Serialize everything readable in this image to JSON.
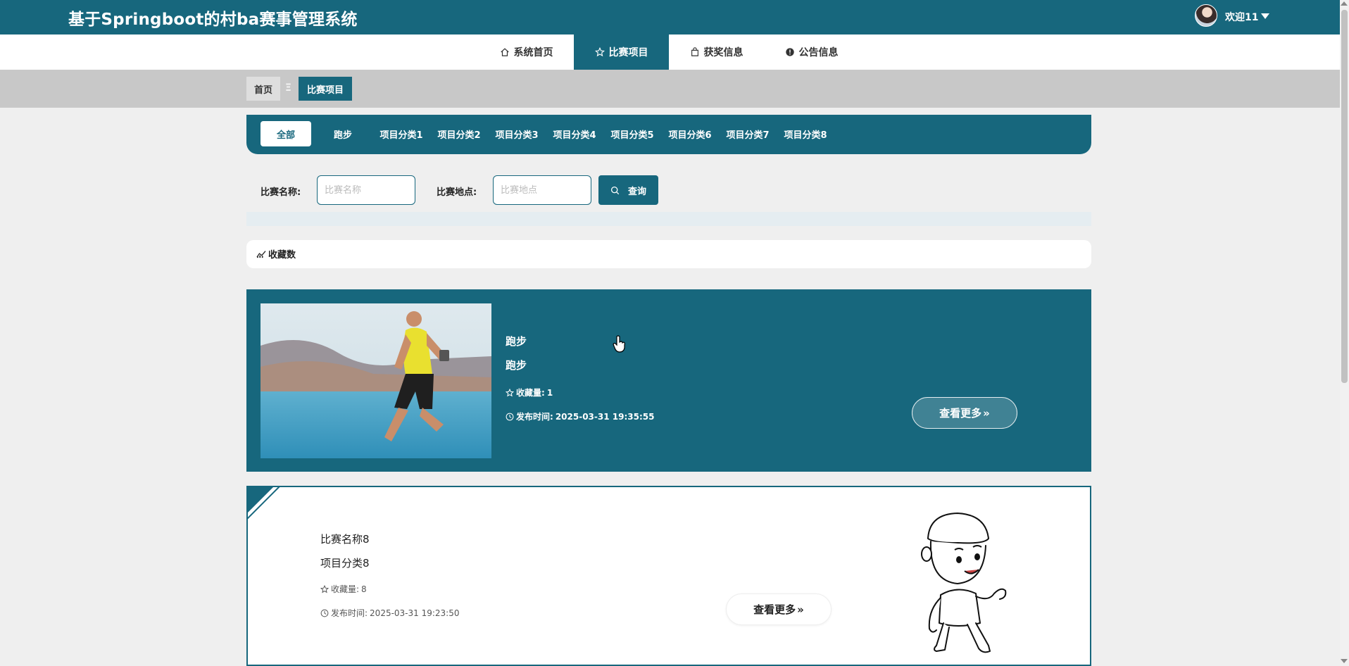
{
  "header": {
    "title": "基于Springboot的村ba赛事管理系统",
    "welcome": "欢迎11"
  },
  "nav": [
    {
      "label": "系统首页",
      "icon": "home-icon"
    },
    {
      "label": "比赛项目",
      "icon": "star-icon",
      "active": true
    },
    {
      "label": "获奖信息",
      "icon": "bag-icon"
    },
    {
      "label": "公告信息",
      "icon": "info-icon"
    }
  ],
  "breadcrumb": {
    "home": "首页",
    "separator": "Ξ",
    "current": "比赛项目"
  },
  "categories": [
    {
      "label": "全部",
      "active": true
    },
    {
      "label": "跑步"
    },
    {
      "label": "项目分类1"
    },
    {
      "label": "项目分类2"
    },
    {
      "label": "项目分类3"
    },
    {
      "label": "项目分类4"
    },
    {
      "label": "项目分类5"
    },
    {
      "label": "项目分类6"
    },
    {
      "label": "项目分类7"
    },
    {
      "label": "项目分类8"
    }
  ],
  "search": {
    "name_label": "比赛名称:",
    "name_placeholder": "比赛名称",
    "name_value": "",
    "place_label": "比赛地点:",
    "place_placeholder": "比赛地点",
    "place_value": "",
    "button": "查询"
  },
  "sort": {
    "label": "收藏数"
  },
  "items": [
    {
      "name": "跑步",
      "category": "跑步",
      "fav_label": "收藏量:",
      "fav_count": "1",
      "time_label": "发布时间:",
      "time": "2025-03-31 19:35:55",
      "more": "查看更多"
    },
    {
      "name": "比赛名称8",
      "category": "项目分类8",
      "fav_label": "收藏量:",
      "fav_count": "8",
      "time_label": "发布时间:",
      "time": "2025-03-31 19:23:50",
      "more": "查看更多"
    }
  ],
  "colors": {
    "primary": "#17677d",
    "background": "#efefef",
    "breadcrumb_bg": "#c8c8c8"
  }
}
